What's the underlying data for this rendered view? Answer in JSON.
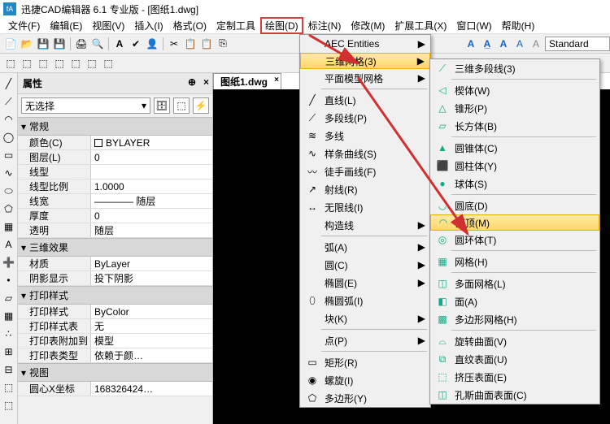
{
  "title": "迅捷CAD编辑器 6.1 专业版 - [图纸1.dwg]",
  "menubar": [
    "文件(F)",
    "编辑(E)",
    "视图(V)",
    "插入(I)",
    "格式(O)",
    "定制工具",
    "绘图(D)",
    "标注(N)",
    "修改(M)",
    "扩展工具(X)",
    "窗口(W)",
    "帮助(H)"
  ],
  "doc_tab": "图纸1.dwg",
  "style_combo": "Standard",
  "prop": {
    "title": "属性",
    "no_sel": "无选择",
    "cats": {
      "general": "常规",
      "fx": "三维效果",
      "print": "打印样式",
      "view": "视图"
    },
    "rows": {
      "color": {
        "l": "颜色(C)",
        "v": "BYLAYER"
      },
      "layer": {
        "l": "图层(L)",
        "v": "0"
      },
      "ltype": {
        "l": "线型",
        "v": ""
      },
      "ltscale": {
        "l": "线型比例",
        "v": "1.0000"
      },
      "lweight": {
        "l": "线宽",
        "v": "———— 随层"
      },
      "thick": {
        "l": "厚度",
        "v": "0"
      },
      "transp": {
        "l": "透明",
        "v": "随层"
      },
      "mat": {
        "l": "材质",
        "v": "ByLayer"
      },
      "shadow": {
        "l": "阴影显示",
        "v": "投下阴影"
      },
      "pstyle": {
        "l": "打印样式",
        "v": "ByColor"
      },
      "ptable": {
        "l": "打印样式表",
        "v": "无"
      },
      "pattach": {
        "l": "打印表附加到",
        "v": "模型"
      },
      "ptype": {
        "l": "打印表类型",
        "v": "依赖于颜…"
      },
      "cx": {
        "l": "圆心X坐标",
        "v": "168326424…"
      }
    }
  },
  "menu1": {
    "aec": "AEC Entities",
    "mesh3d": "三维网格(3)",
    "flatmesh": "平面模型网格",
    "line": "直线(L)",
    "pline": "多段线(P)",
    "mline": "多线",
    "spline": "样条曲线(S)",
    "freehand": "徒手画线(F)",
    "ray": "射线(R)",
    "xline": "无限线(I)",
    "constr": "构造线",
    "arc": "弧(A)",
    "circle": "圆(C)",
    "ellipse": "椭圆(E)",
    "earc": "椭圆弧(I)",
    "block": "块(K)",
    "point": "点(P)",
    "rect": "矩形(R)",
    "spiral": "螺旋(I)",
    "poly": "多边形(Y)"
  },
  "menu2": {
    "pline3d": "三维多段线(3)",
    "wedge": "楔体(W)",
    "cone": "锥形(P)",
    "box": "长方体(B)",
    "conesolid": "圆锥体(C)",
    "cyl": "圆柱体(Y)",
    "sphere": "球体(S)",
    "dishlow": "圆底(D)",
    "dome": "圆顶(M)",
    "torus": "圆环体(T)",
    "mesh": "网格(H)",
    "pface": "多面网格(L)",
    "face": "面(A)",
    "polymesh": "多边形网格(H)",
    "revsurf": "旋转曲面(V)",
    "rulesurf": "直纹表面(U)",
    "extrsurf": "挤压表面(E)",
    "coons": "孔斯曲面表面(C)"
  }
}
